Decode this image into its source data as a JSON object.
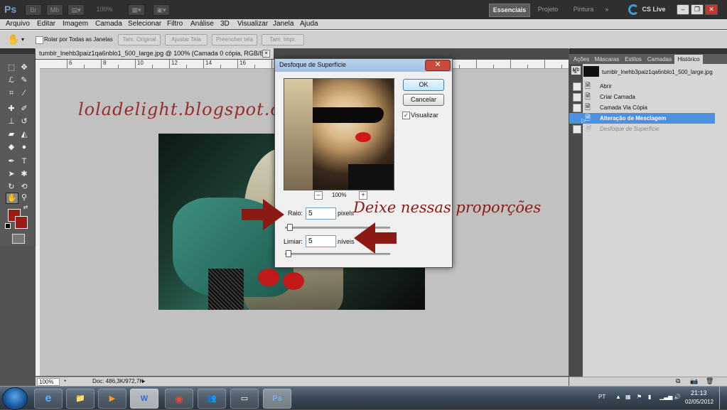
{
  "app": {
    "logo": "Ps",
    "bar_buttons": [
      "Br",
      "Mb",
      "100%"
    ],
    "workspaces": {
      "essenciais": "Essenciais",
      "projeto": "Projeto",
      "pintura": "Pintura",
      "more": "»"
    },
    "cs_live": "CS Live",
    "window_controls": {
      "minimize": "–",
      "restore": "❐",
      "close": "✕"
    }
  },
  "menu": [
    "Arquivo",
    "Editar",
    "Imagem",
    "Camada",
    "Selecionar",
    "Filtro",
    "Análise",
    "3D",
    "Visualizar",
    "Janela",
    "Ajuda"
  ],
  "options": {
    "rolar_label": "Rolar por Todas as Janelas",
    "buttons": [
      "Tam. Original",
      "Ajustar Tela",
      "Preencher tela",
      "Tam. Impr."
    ]
  },
  "document": {
    "tab_title": "tumblr_lnehb3paiz1qa6nblo1_500_large.jpg @ 100% (Camada 0 cópia, RGB/8) *",
    "tab_close": "✕",
    "ruler_numbers": [
      "6",
      "8",
      "10",
      "12",
      "14",
      "16",
      "18",
      "20",
      "22",
      "24",
      "26",
      "28"
    ],
    "zoom": "100%",
    "doc_info": "Doc: 486,3K/972,7K"
  },
  "watermark": "loladelight.blogspot.com",
  "annotation": "Deixe nessas proporções",
  "dialog": {
    "title": "Desfoque de Superfície",
    "close": "✕",
    "ok": "OK",
    "cancel": "Cancelar",
    "preview_label": "Visualizar",
    "preview_zoom": "100%",
    "zoom_out": "–",
    "zoom_in": "+",
    "raio_label": "Raio:",
    "raio_value": "5",
    "raio_unit": "pixels",
    "limiar_label": "Limiar:",
    "limiar_value": "5",
    "limiar_unit": "níveis"
  },
  "panel": {
    "tabs": [
      "Ações",
      "Máscaras",
      "Estilos",
      "Camadas",
      "Histórico"
    ],
    "snapshot": "tumblr_lnehb3paiz1qa6nblo1_500_large.jpg",
    "history": [
      "Abrir",
      "Criar Camada",
      "Camada Via Cópia",
      "Alteração de Mesclagem",
      "Desfoque de Superfície"
    ]
  },
  "taskbar": {
    "apps": [
      "e",
      "📁",
      "▶",
      "W",
      "◉",
      "👥",
      "▭",
      "Ps"
    ],
    "lang": "PT",
    "time": "21:13",
    "date": "02/05/2012"
  },
  "colors": {
    "foreground": "#9b1c14",
    "background": "#9b1c14",
    "annotation": "#8b1a14",
    "selection": "#4d90e0"
  }
}
